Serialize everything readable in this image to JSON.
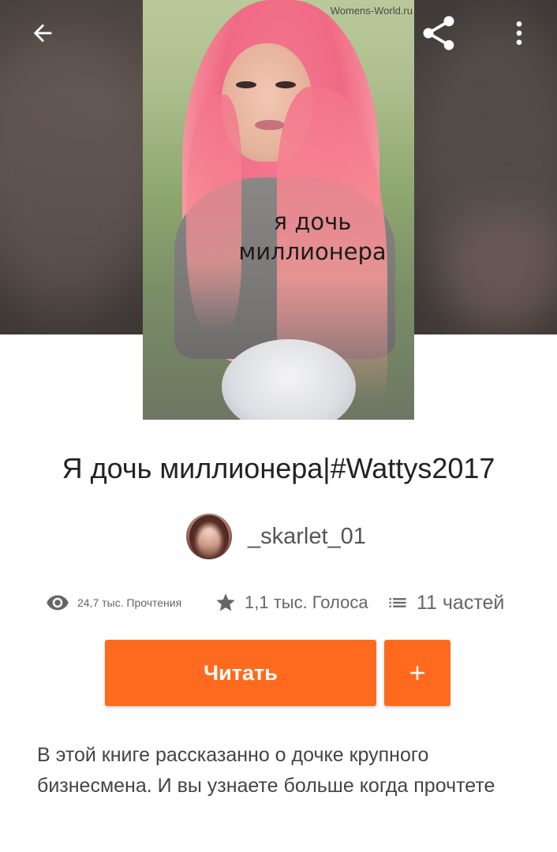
{
  "cover": {
    "watermark": "Womens-World.ru",
    "title_line1": "я дочь",
    "title_line2": "миллионера"
  },
  "book": {
    "title": "Я дочь миллионера|#Wattys2017"
  },
  "author": {
    "name": "_skarlet_01"
  },
  "stats": {
    "reads": "24,7 тыс. Прочтения",
    "votes": "1,1 тыс. Голоса",
    "parts": "11 частей"
  },
  "actions": {
    "read_label": "Читать",
    "add_label": "+"
  },
  "description": "В этой книге рассказанно о дочке крупного бизнесмена. И вы узнаете больше когда прочтете",
  "colors": {
    "accent": "#ff6a1f",
    "text_primary": "#222222",
    "text_secondary": "#666666"
  },
  "icons": {
    "back": "arrow-left-icon",
    "share": "share-icon",
    "more": "more-vertical-icon",
    "reads": "eye-icon",
    "votes": "star-icon",
    "parts": "list-icon",
    "add": "plus-icon"
  }
}
